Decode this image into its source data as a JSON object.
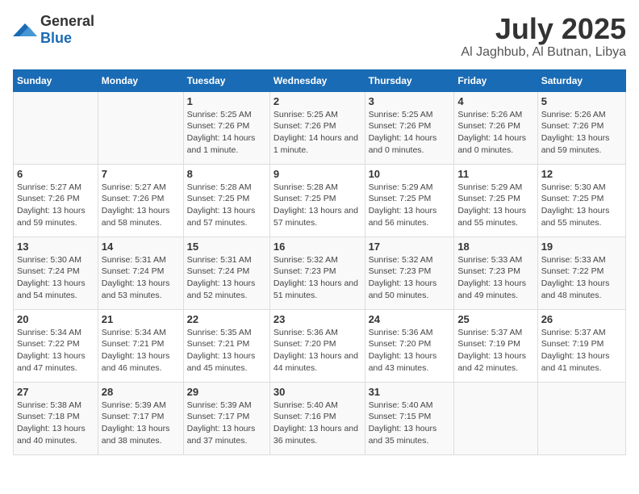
{
  "header": {
    "logo": {
      "text1": "General",
      "text2": "Blue"
    },
    "title": "July 2025",
    "subtitle": "Al Jaghbub, Al Butnan, Libya"
  },
  "weekdays": [
    "Sunday",
    "Monday",
    "Tuesday",
    "Wednesday",
    "Thursday",
    "Friday",
    "Saturday"
  ],
  "weeks": [
    [
      {
        "day": "",
        "info": ""
      },
      {
        "day": "",
        "info": ""
      },
      {
        "day": "1",
        "info": "Sunrise: 5:25 AM\nSunset: 7:26 PM\nDaylight: 14 hours and 1 minute."
      },
      {
        "day": "2",
        "info": "Sunrise: 5:25 AM\nSunset: 7:26 PM\nDaylight: 14 hours and 1 minute."
      },
      {
        "day": "3",
        "info": "Sunrise: 5:25 AM\nSunset: 7:26 PM\nDaylight: 14 hours and 0 minutes."
      },
      {
        "day": "4",
        "info": "Sunrise: 5:26 AM\nSunset: 7:26 PM\nDaylight: 14 hours and 0 minutes."
      },
      {
        "day": "5",
        "info": "Sunrise: 5:26 AM\nSunset: 7:26 PM\nDaylight: 13 hours and 59 minutes."
      }
    ],
    [
      {
        "day": "6",
        "info": "Sunrise: 5:27 AM\nSunset: 7:26 PM\nDaylight: 13 hours and 59 minutes."
      },
      {
        "day": "7",
        "info": "Sunrise: 5:27 AM\nSunset: 7:26 PM\nDaylight: 13 hours and 58 minutes."
      },
      {
        "day": "8",
        "info": "Sunrise: 5:28 AM\nSunset: 7:25 PM\nDaylight: 13 hours and 57 minutes."
      },
      {
        "day": "9",
        "info": "Sunrise: 5:28 AM\nSunset: 7:25 PM\nDaylight: 13 hours and 57 minutes."
      },
      {
        "day": "10",
        "info": "Sunrise: 5:29 AM\nSunset: 7:25 PM\nDaylight: 13 hours and 56 minutes."
      },
      {
        "day": "11",
        "info": "Sunrise: 5:29 AM\nSunset: 7:25 PM\nDaylight: 13 hours and 55 minutes."
      },
      {
        "day": "12",
        "info": "Sunrise: 5:30 AM\nSunset: 7:25 PM\nDaylight: 13 hours and 55 minutes."
      }
    ],
    [
      {
        "day": "13",
        "info": "Sunrise: 5:30 AM\nSunset: 7:24 PM\nDaylight: 13 hours and 54 minutes."
      },
      {
        "day": "14",
        "info": "Sunrise: 5:31 AM\nSunset: 7:24 PM\nDaylight: 13 hours and 53 minutes."
      },
      {
        "day": "15",
        "info": "Sunrise: 5:31 AM\nSunset: 7:24 PM\nDaylight: 13 hours and 52 minutes."
      },
      {
        "day": "16",
        "info": "Sunrise: 5:32 AM\nSunset: 7:23 PM\nDaylight: 13 hours and 51 minutes."
      },
      {
        "day": "17",
        "info": "Sunrise: 5:32 AM\nSunset: 7:23 PM\nDaylight: 13 hours and 50 minutes."
      },
      {
        "day": "18",
        "info": "Sunrise: 5:33 AM\nSunset: 7:23 PM\nDaylight: 13 hours and 49 minutes."
      },
      {
        "day": "19",
        "info": "Sunrise: 5:33 AM\nSunset: 7:22 PM\nDaylight: 13 hours and 48 minutes."
      }
    ],
    [
      {
        "day": "20",
        "info": "Sunrise: 5:34 AM\nSunset: 7:22 PM\nDaylight: 13 hours and 47 minutes."
      },
      {
        "day": "21",
        "info": "Sunrise: 5:34 AM\nSunset: 7:21 PM\nDaylight: 13 hours and 46 minutes."
      },
      {
        "day": "22",
        "info": "Sunrise: 5:35 AM\nSunset: 7:21 PM\nDaylight: 13 hours and 45 minutes."
      },
      {
        "day": "23",
        "info": "Sunrise: 5:36 AM\nSunset: 7:20 PM\nDaylight: 13 hours and 44 minutes."
      },
      {
        "day": "24",
        "info": "Sunrise: 5:36 AM\nSunset: 7:20 PM\nDaylight: 13 hours and 43 minutes."
      },
      {
        "day": "25",
        "info": "Sunrise: 5:37 AM\nSunset: 7:19 PM\nDaylight: 13 hours and 42 minutes."
      },
      {
        "day": "26",
        "info": "Sunrise: 5:37 AM\nSunset: 7:19 PM\nDaylight: 13 hours and 41 minutes."
      }
    ],
    [
      {
        "day": "27",
        "info": "Sunrise: 5:38 AM\nSunset: 7:18 PM\nDaylight: 13 hours and 40 minutes."
      },
      {
        "day": "28",
        "info": "Sunrise: 5:39 AM\nSunset: 7:17 PM\nDaylight: 13 hours and 38 minutes."
      },
      {
        "day": "29",
        "info": "Sunrise: 5:39 AM\nSunset: 7:17 PM\nDaylight: 13 hours and 37 minutes."
      },
      {
        "day": "30",
        "info": "Sunrise: 5:40 AM\nSunset: 7:16 PM\nDaylight: 13 hours and 36 minutes."
      },
      {
        "day": "31",
        "info": "Sunrise: 5:40 AM\nSunset: 7:15 PM\nDaylight: 13 hours and 35 minutes."
      },
      {
        "day": "",
        "info": ""
      },
      {
        "day": "",
        "info": ""
      }
    ]
  ]
}
